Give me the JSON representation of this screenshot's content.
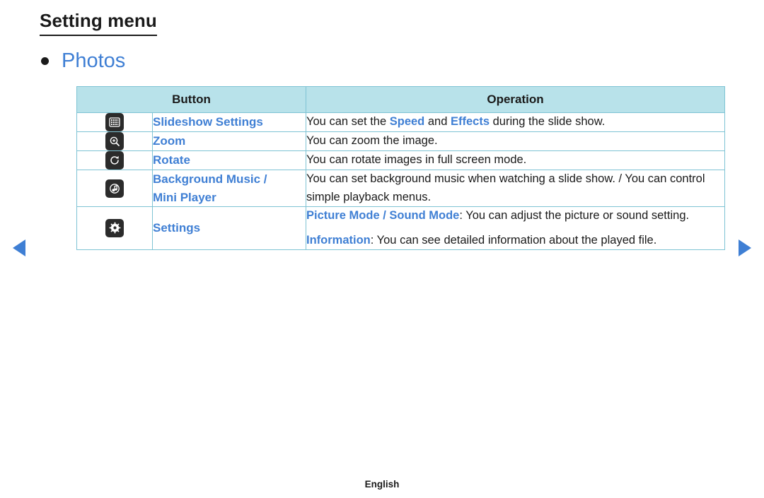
{
  "document": {
    "title": "Setting menu",
    "section_heading": "Photos",
    "footer_language": "English",
    "accent_color": "#3f7fd4",
    "table_header_bg": "#b8e2ea",
    "table_border_color": "#7ec3d4"
  },
  "table": {
    "headers": [
      "Button",
      "Operation"
    ],
    "rows": [
      {
        "icon": "slideshow-settings-icon",
        "name": "Slideshow Settings",
        "operation_parts": [
          {
            "text": "You can set the ",
            "style": "normal"
          },
          {
            "text": "Speed",
            "style": "blue"
          },
          {
            "text": " and ",
            "style": "normal"
          },
          {
            "text": "Effects",
            "style": "blue"
          },
          {
            "text": " during the slide show.",
            "style": "normal"
          }
        ]
      },
      {
        "icon": "zoom-icon",
        "name": "Zoom",
        "operation_parts": [
          {
            "text": "You can zoom the image.",
            "style": "normal"
          }
        ]
      },
      {
        "icon": "rotate-icon",
        "name": "Rotate",
        "operation_parts": [
          {
            "text": "You can rotate images in full screen mode.",
            "style": "normal"
          }
        ]
      },
      {
        "icon": "background-music-icon",
        "name": "Background Music / Mini Player",
        "name_line1": "Background Music /",
        "name_line2": "Mini Player",
        "operation_parts": [
          {
            "text": "You can set background music when watching a slide show. / You can control simple playback menus.",
            "style": "normal"
          }
        ]
      },
      {
        "icon": "settings-gear-icon",
        "name": "Settings",
        "operation_parts": [
          {
            "text": "Picture Mode / Sound Mode",
            "style": "blue"
          },
          {
            "text": ": You can adjust the picture or sound setting.",
            "style": "normal"
          },
          {
            "text": "\n",
            "style": "break"
          },
          {
            "text": "Information",
            "style": "blue"
          },
          {
            "text": ": You can see detailed information about the played file.",
            "style": "normal"
          }
        ]
      }
    ]
  },
  "navigation": {
    "previous_label": "Previous page",
    "next_label": "Next page"
  }
}
